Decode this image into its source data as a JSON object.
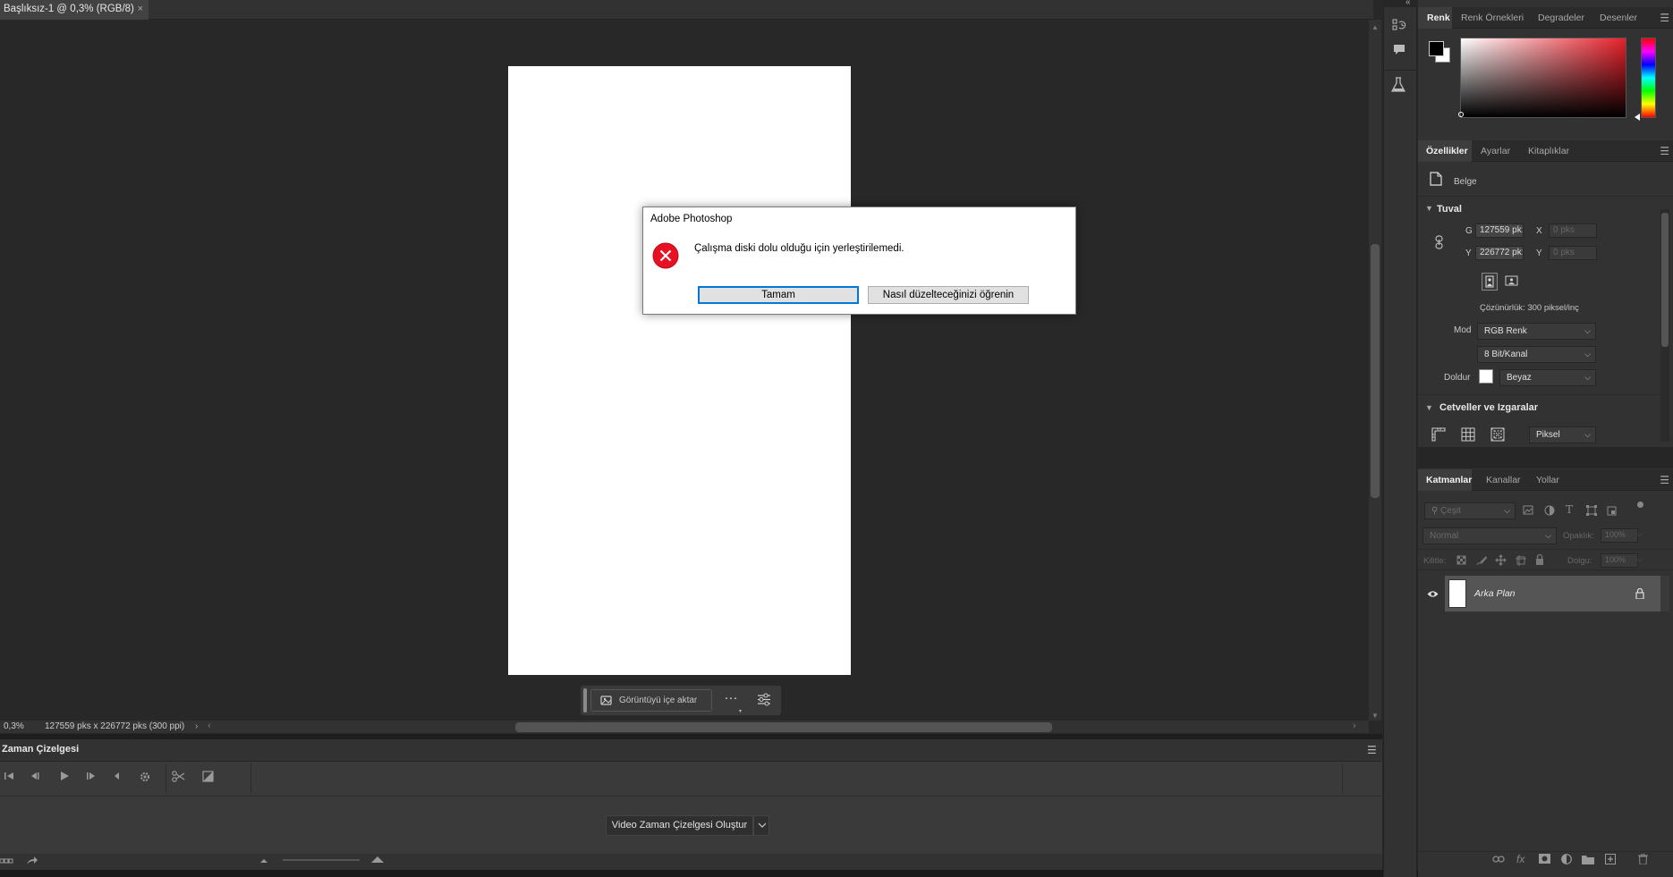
{
  "document": {
    "tab_title": "Başlıksız-1 @ 0,3% (RGB/8)",
    "close_glyph": "×"
  },
  "status": {
    "zoom": "0,3%",
    "dimensions": "127559 pks x 226772 pks (300 ppi)"
  },
  "context_bar": {
    "import_label": "Görüntüyü içe aktar",
    "more_glyph": "···"
  },
  "timeline": {
    "title": "Zaman Çizelgesi",
    "create_button": "Video Zaman Çizelgesi Oluştur"
  },
  "color_panel": {
    "tabs": [
      "Renk",
      "Renk Örnekleri",
      "Degradeler",
      "Desenler"
    ],
    "foreground": "#000000",
    "background": "#ffffff"
  },
  "properties_panel": {
    "tabs": [
      "Özellikler",
      "Ayarlar",
      "Kitaplıklar"
    ],
    "doc_type": "Belge",
    "canvas_section": "Tuval",
    "w_label": "G",
    "w_value": "127559 pk:",
    "h_label": "Y",
    "h_value": "226772 pk:",
    "x_label": "X",
    "x_placeholder": "0 pks",
    "y_label": "Y",
    "y_placeholder": "0 pks",
    "resolution": "Çözünürlük: 300 piksel/inç",
    "mode_label": "Mod",
    "mode_value": "RGB Renk",
    "bit_value": "8 Bit/Kanal",
    "fill_label": "Doldur",
    "fill_value": "Beyaz",
    "rulers_section": "Cetveller ve Izgaralar",
    "unit_value": "Piksel"
  },
  "layers_panel": {
    "tabs": [
      "Katmanlar",
      "Kanallar",
      "Yollar"
    ],
    "filter_placeholder": "Çeşit",
    "blend_mode": "Normal",
    "opacity_label": "Opaklık:",
    "opacity_value": "100%",
    "lock_label": "Kilitle:",
    "fill_label": "Dolgu:",
    "fill_value": "100%",
    "layer_name": "Arka Plan"
  },
  "dialog": {
    "title": "Adobe Photoshop",
    "message": "Çalışma diski dolu olduğu için yerleştirilemedi.",
    "ok_button": "Tamam",
    "learn_button": "Nasıl düzelteceğinizi öğrenin"
  }
}
